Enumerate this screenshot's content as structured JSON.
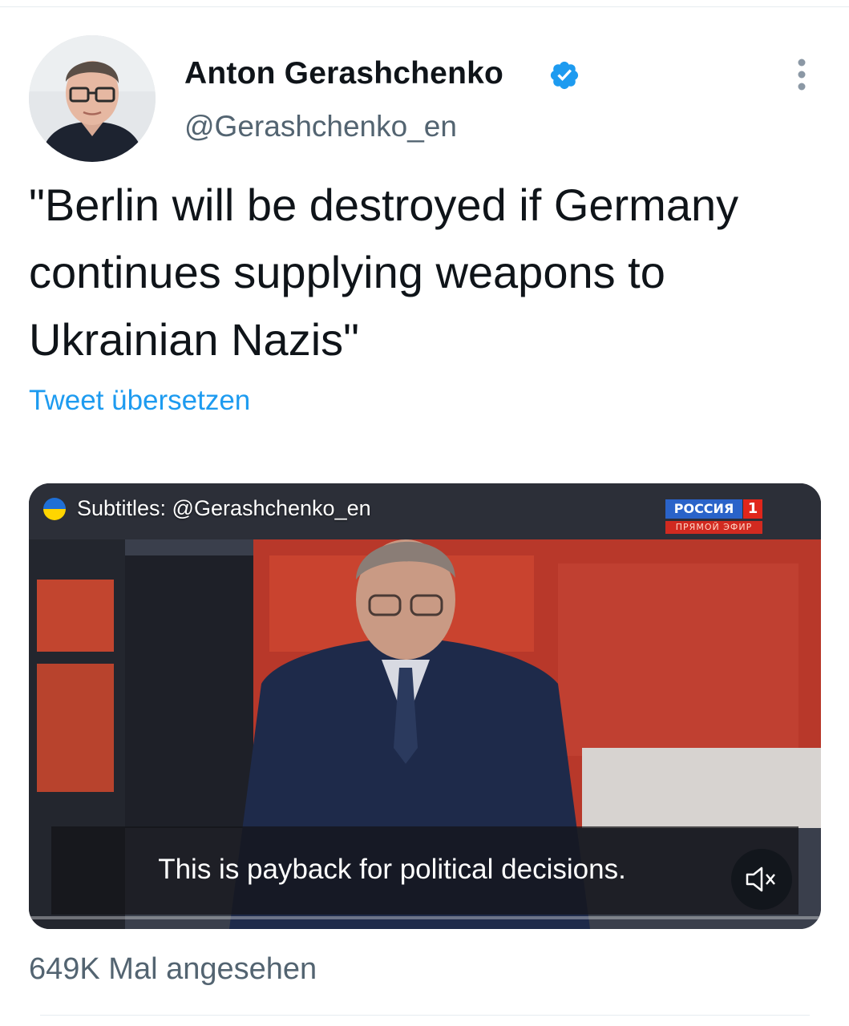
{
  "author": {
    "display_name": "Anton Gerashchenko",
    "handle": "@Gerashchenko_en",
    "verified": true,
    "avatar_icon": "profile-photo"
  },
  "tweet": {
    "text": "\"Berlin will be destroyed if Germany continues supplying weapons to Ukrainian Nazis\"",
    "translate_label": "Tweet übersetzen"
  },
  "video": {
    "credit": "Subtitles: @Gerashchenko_en",
    "channel_logo": {
      "name": "РОССИЯ",
      "number": "1",
      "subtitle": "ПРЯМОЙ ЭФИР"
    },
    "subtitle": "This is payback for political decisions.",
    "muted": true
  },
  "stats": {
    "views": "649K Mal angesehen"
  },
  "colors": {
    "accent": "#1d9bf0",
    "secondary_text": "#536471",
    "primary_text": "#0f1419"
  }
}
